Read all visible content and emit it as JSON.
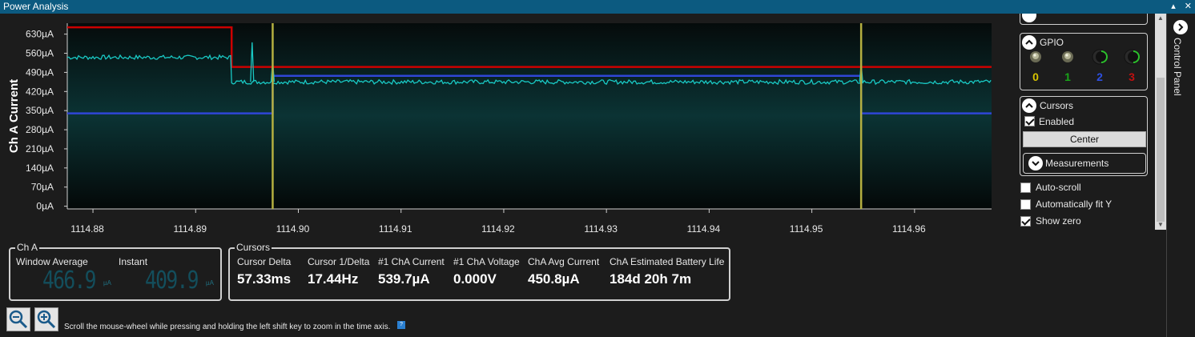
{
  "window": {
    "title": "Power Analysis",
    "pin_icon": "pin-icon",
    "close_icon": "close-icon"
  },
  "chart_data": {
    "type": "line",
    "ylabel": "Ch A Current",
    "yticks": [
      "0µA",
      "70µA",
      "140µA",
      "210µA",
      "280µA",
      "350µA",
      "420µA",
      "490µA",
      "560µA",
      "630µA"
    ],
    "ylim": [
      -10,
      670
    ],
    "xticks": [
      "1114.88",
      "1114.89",
      "1114.90",
      "1114.91",
      "1114.92",
      "1114.93",
      "1114.94",
      "1114.95",
      "1114.96"
    ],
    "xlim": [
      1114.8775,
      1114.9675
    ],
    "grid": false,
    "series": [
      {
        "color": "#cc0000",
        "style": "step",
        "points": [
          [
            1114.8775,
            655
          ],
          [
            1114.8935,
            655
          ],
          [
            1114.8935,
            510
          ],
          [
            1114.9675,
            510
          ]
        ]
      },
      {
        "color": "#2f46d6",
        "style": "step",
        "points": [
          [
            1114.8775,
            340
          ],
          [
            1114.8975,
            340
          ],
          [
            1114.8975,
            477
          ],
          [
            1114.9548,
            477
          ],
          [
            1114.9548,
            340
          ],
          [
            1114.9675,
            340
          ]
        ]
      },
      {
        "color": "#19c9c4",
        "style": "noisy",
        "segments": [
          [
            1114.8775,
            1114.8935,
            545
          ],
          [
            1114.8935,
            1114.9675,
            455
          ]
        ],
        "spikes": [
          [
            1114.8955,
            600
          ],
          [
            1114.8975,
            530
          ],
          [
            1114.9548,
            520
          ]
        ]
      }
    ],
    "cursors": [
      1114.8975,
      1114.9548
    ],
    "cursor_color": "#b5b040",
    "line_color_trace": "#19c9c4"
  },
  "cha": {
    "title": "Ch A",
    "window_average_label": "Window Average",
    "window_average_value": "466.9",
    "instant_label": "Instant",
    "instant_value": "409.9",
    "unit": "µA"
  },
  "cursors_box": {
    "title": "Cursors",
    "items": [
      {
        "label": "Cursor Delta",
        "value": "57.33ms"
      },
      {
        "label": "Cursor 1/Delta",
        "value": "17.44Hz"
      },
      {
        "label": "#1 ChA Current",
        "value": "539.7µA"
      },
      {
        "label": "#1 ChA Voltage",
        "value": "0.000V"
      },
      {
        "label": "ChA Avg Current",
        "value": "450.8µA"
      },
      {
        "label": "ChA Estimated Battery Life",
        "value": "184d 20h 7m"
      }
    ]
  },
  "bottom": {
    "zoom_out_icon": "zoom-out-icon",
    "zoom_in_icon": "zoom-in-icon",
    "hint": "Scroll the mouse-wheel while pressing and holding the left shift key to zoom in the time axis.",
    "help": "?"
  },
  "control_panel": {
    "tab_label": "Control Panel",
    "gpio": {
      "title": "GPIO",
      "pins": [
        {
          "label": "0",
          "color": "#d8c400",
          "state": "off"
        },
        {
          "label": "1",
          "color": "#19a619",
          "state": "off"
        },
        {
          "label": "2",
          "color": "#2d4fe0",
          "state": "on"
        },
        {
          "label": "3",
          "color": "#c01010",
          "state": "on"
        }
      ]
    },
    "cursors": {
      "title": "Cursors",
      "enabled_label": "Enabled",
      "enabled": true,
      "center_label": "Center",
      "measurements_label": "Measurements"
    },
    "options": [
      {
        "label": "Auto-scroll",
        "checked": false
      },
      {
        "label": "Automatically fit Y",
        "checked": false
      },
      {
        "label": "Show zero",
        "checked": true
      }
    ]
  }
}
